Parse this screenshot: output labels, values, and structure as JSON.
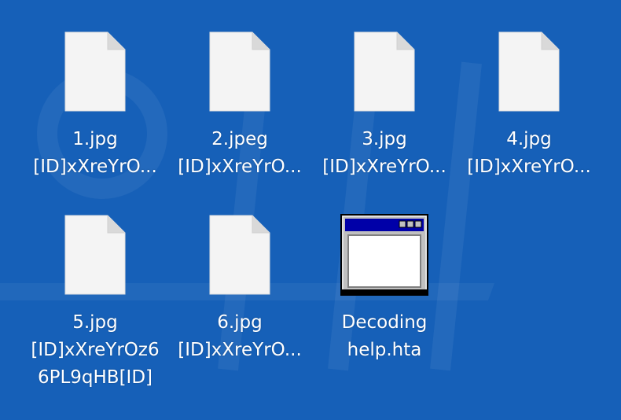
{
  "desktop": {
    "background_color": "#1660b8",
    "files": [
      {
        "icon": "blank-document-icon",
        "name_line1": "1.jpg",
        "name_line2": "[ID]xXreYrO..."
      },
      {
        "icon": "blank-document-icon",
        "name_line1": "2.jpeg",
        "name_line2": "[ID]xXreYrO..."
      },
      {
        "icon": "blank-document-icon",
        "name_line1": "3.jpg",
        "name_line2": "[ID]xXreYrO..."
      },
      {
        "icon": "blank-document-icon",
        "name_line1": "4.jpg",
        "name_line2": "[ID]xXreYrO..."
      },
      {
        "icon": "blank-document-icon",
        "name_line1": "5.jpg",
        "name_line2": "[ID]xXreYrOz6",
        "name_line3": "6PL9qHB[ID]"
      },
      {
        "icon": "blank-document-icon",
        "name_line1": "6.jpg",
        "name_line2": "[ID]xXreYrO..."
      },
      {
        "icon": "application-window-icon",
        "name_line1": "Decoding",
        "name_line2": "help.hta"
      }
    ]
  }
}
